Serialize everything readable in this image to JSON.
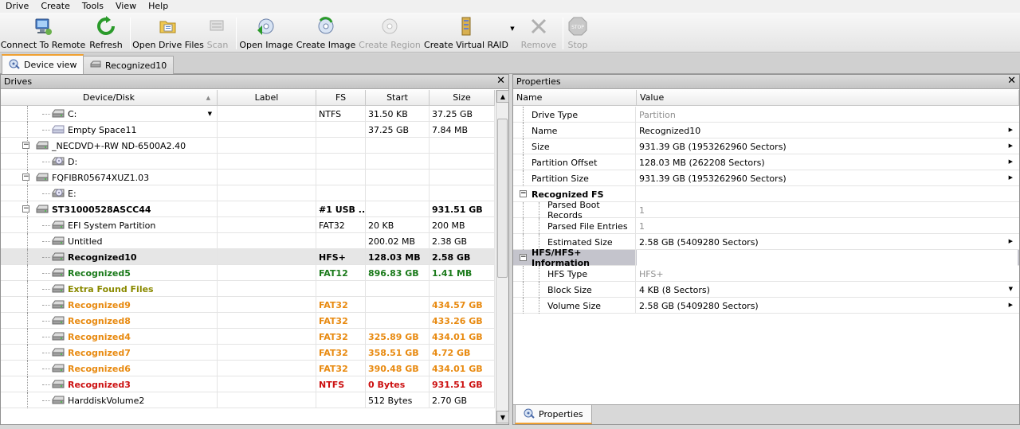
{
  "menu": [
    "Drive",
    "Create",
    "Tools",
    "View",
    "Help"
  ],
  "toolbar": {
    "connect": "Connect To Remote",
    "refresh": "Refresh",
    "open_drive_files": "Open Drive Files",
    "scan": "Scan",
    "open_image": "Open Image",
    "create_image": "Create Image",
    "create_region": "Create Region",
    "create_virtual_raid": "Create Virtual RAID",
    "remove": "Remove",
    "stop": "Stop"
  },
  "tabs": {
    "device_view": "Device view",
    "recognized10": "Recognized10"
  },
  "drives": {
    "title": "Drives",
    "columns": {
      "device": "Device/Disk",
      "label": "Label",
      "fs": "FS",
      "start": "Start",
      "size": "Size"
    },
    "rows": [
      {
        "name": "C:",
        "label": "",
        "fs": "NTFS",
        "start": "31.50 KB",
        "size": "37.25 GB"
      },
      {
        "name": "Empty Space11",
        "label": "",
        "fs": "",
        "start": "37.25 GB",
        "size": "7.84 MB"
      },
      {
        "name": "_NECDVD+-RW ND-6500A2.40",
        "label": "",
        "fs": "",
        "start": "",
        "size": ""
      },
      {
        "name": "D:",
        "label": "",
        "fs": "",
        "start": "",
        "size": ""
      },
      {
        "name": "FQFIBR05674XUZ1.03",
        "label": "",
        "fs": "",
        "start": "",
        "size": ""
      },
      {
        "name": "E:",
        "label": "",
        "fs": "",
        "start": "",
        "size": ""
      },
      {
        "name": "ST31000528ASCC44",
        "label": "",
        "fs": "#1 USB ...",
        "start": "",
        "size": "931.51 GB"
      },
      {
        "name": "EFI System Partition",
        "label": "",
        "fs": "FAT32",
        "start": "20 KB",
        "size": "200 MB"
      },
      {
        "name": "Untitled",
        "label": "",
        "fs": "",
        "start": "200.02 MB",
        "size": "2.38 GB"
      },
      {
        "name": "Recognized10",
        "label": "",
        "fs": "HFS+",
        "start": "128.03 MB",
        "size": "2.58 GB"
      },
      {
        "name": "Recognized5",
        "label": "",
        "fs": "FAT12",
        "start": "896.83 GB",
        "size": "1.41 MB"
      },
      {
        "name": "Extra Found Files",
        "label": "",
        "fs": "",
        "start": "",
        "size": ""
      },
      {
        "name": "Recognized9",
        "label": "",
        "fs": "FAT32",
        "start": "",
        "size": "434.57 GB"
      },
      {
        "name": "Recognized8",
        "label": "",
        "fs": "FAT32",
        "start": "",
        "size": "433.26 GB"
      },
      {
        "name": "Recognized4",
        "label": "",
        "fs": "FAT32",
        "start": "325.89 GB",
        "size": "434.01 GB"
      },
      {
        "name": "Recognized7",
        "label": "",
        "fs": "FAT32",
        "start": "358.51 GB",
        "size": "4.72 GB"
      },
      {
        "name": "Recognized6",
        "label": "",
        "fs": "FAT32",
        "start": "390.48 GB",
        "size": "434.01 GB"
      },
      {
        "name": "Recognized3",
        "label": "",
        "fs": "NTFS",
        "start": "0 Bytes",
        "size": "931.51 GB"
      },
      {
        "name": "HarddiskVolume2",
        "label": "",
        "fs": "",
        "start": "512 Bytes",
        "size": "2.70 GB"
      }
    ]
  },
  "properties": {
    "title": "Properties",
    "columns": {
      "name": "Name",
      "value": "Value"
    },
    "rows": [
      {
        "name": "Drive Type",
        "value": "Partition"
      },
      {
        "name": "Name",
        "value": "Recognized10"
      },
      {
        "name": "Size",
        "value": "931.39 GB (1953262960 Sectors)"
      },
      {
        "name": "Partition Offset",
        "value": "128.03 MB (262208 Sectors)"
      },
      {
        "name": "Partition Size",
        "value": "931.39 GB (1953262960 Sectors)"
      },
      {
        "name": "Recognized FS",
        "value": ""
      },
      {
        "name": "Parsed Boot Records",
        "value": "1"
      },
      {
        "name": "Parsed File Entries",
        "value": "1"
      },
      {
        "name": "Estimated Size",
        "value": "2.58 GB (5409280 Sectors)"
      },
      {
        "name": "HFS/HFS+ Information",
        "value": ""
      },
      {
        "name": "HFS Type",
        "value": "HFS+"
      },
      {
        "name": "Block Size",
        "value": "4 KB (8 Sectors)"
      },
      {
        "name": "Volume Size",
        "value": "2.58 GB (5409280 Sectors)"
      }
    ],
    "bottom_tab": "Properties"
  },
  "colors": {
    "green": "#1a7a1a",
    "orange": "#e88a10",
    "olive": "#8a8a00",
    "red": "#cc1010",
    "accent_tab": "#f0a030"
  }
}
